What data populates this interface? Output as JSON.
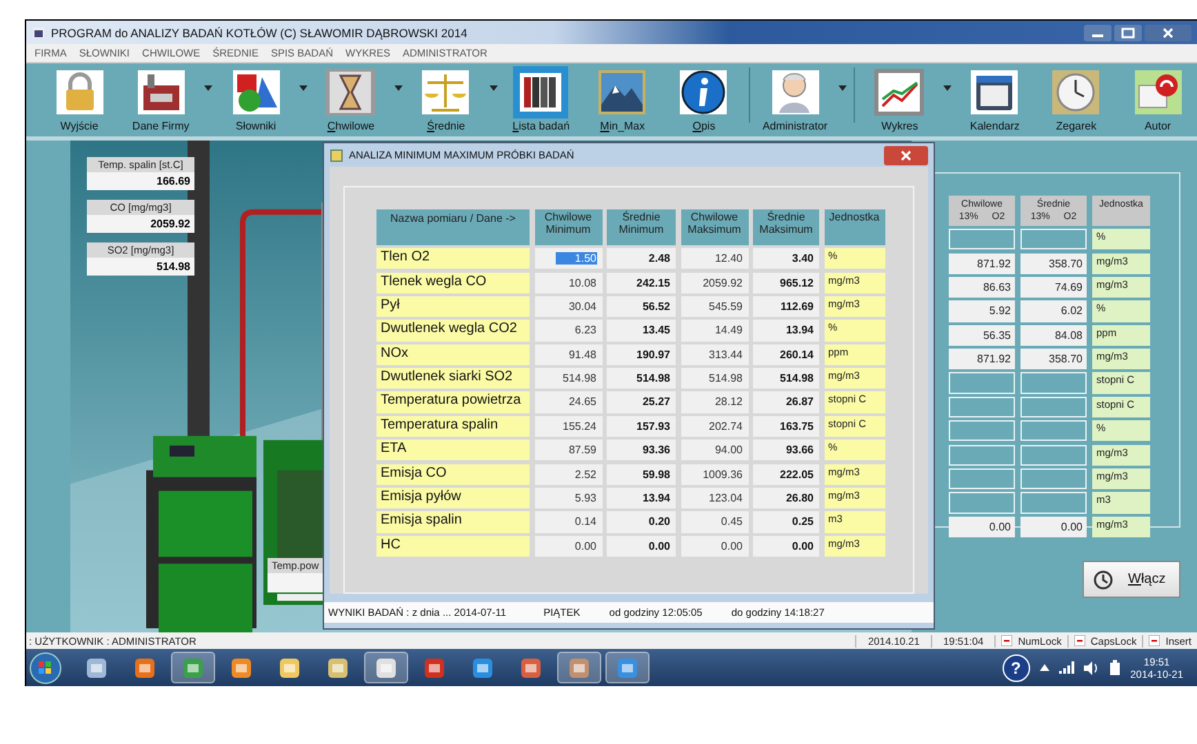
{
  "window": {
    "title": "PROGRAM do ANALIZY BADAŃ KOTŁÓW (C) SŁAWOMIR DĄBROWSKI 2014"
  },
  "menu": [
    "FIRMA",
    "SŁOWNIKI",
    "CHWILOWE",
    "ŚREDNIE",
    "SPIS BADAŃ",
    "WYKRES",
    "ADMINISTRATOR"
  ],
  "toolbar": [
    {
      "label": "Wyjście",
      "dropdown": false,
      "mnemonic": false,
      "selected": false,
      "separator_before": false
    },
    {
      "label": "Dane Firmy",
      "dropdown": true,
      "mnemonic": false,
      "selected": false,
      "separator_before": false
    },
    {
      "label": "Słowniki",
      "dropdown": true,
      "mnemonic": false,
      "selected": false,
      "separator_before": false
    },
    {
      "label": "Chwilowe",
      "dropdown": true,
      "mnemonic": true,
      "selected": false,
      "separator_before": false
    },
    {
      "label": "Średnie",
      "dropdown": true,
      "mnemonic": true,
      "selected": false,
      "separator_before": false
    },
    {
      "label": "Lista badań",
      "dropdown": false,
      "mnemonic": true,
      "selected": true,
      "separator_before": false
    },
    {
      "label": "Min_Max",
      "dropdown": false,
      "mnemonic": true,
      "selected": false,
      "separator_before": false
    },
    {
      "label": "Opis",
      "dropdown": false,
      "mnemonic": true,
      "selected": false,
      "separator_before": false
    },
    {
      "label": "Administrator",
      "dropdown": true,
      "mnemonic": false,
      "selected": false,
      "separator_before": true
    },
    {
      "label": "Wykres",
      "dropdown": true,
      "mnemonic": false,
      "selected": false,
      "separator_before": true
    },
    {
      "label": "Kalendarz",
      "dropdown": false,
      "mnemonic": false,
      "selected": false,
      "separator_before": false
    },
    {
      "label": "Zegarek",
      "dropdown": false,
      "mnemonic": false,
      "selected": false,
      "separator_before": false
    },
    {
      "label": "Autor",
      "dropdown": false,
      "mnemonic": false,
      "selected": false,
      "separator_before": false
    }
  ],
  "readouts": [
    {
      "label": "Temp. spalin [st.C]",
      "value": "166.69"
    },
    {
      "label": "CO [mg/mg3]",
      "value": "2059.92"
    },
    {
      "label": "SO2 [mg/mg3]",
      "value": "514.98"
    }
  ],
  "partial_readout": {
    "label": "Temp.pow"
  },
  "right_panel": {
    "columns": [
      "Chwilowe 13% O2",
      "Średnie 13% O2",
      "Jednostka"
    ],
    "rows": [
      {
        "unit": "%"
      },
      {
        "c13": "871.92",
        "s13": "358.70",
        "unit": "mg/m3"
      },
      {
        "c13": "86.63",
        "s13": "74.69",
        "unit": "mg/m3"
      },
      {
        "c13": "5.92",
        "s13": "6.02",
        "unit": "%"
      },
      {
        "c13": "56.35",
        "s13": "84.08",
        "unit": "ppm"
      },
      {
        "c13": "871.92",
        "s13": "358.70",
        "unit": "mg/m3"
      },
      {
        "unit": "stopni C"
      },
      {
        "unit": "stopni C"
      },
      {
        "unit": "%"
      },
      {
        "unit": "mg/m3"
      },
      {
        "unit": "mg/m3"
      },
      {
        "unit": "m3"
      },
      {
        "c13": "0.00",
        "s13": "0.00",
        "unit": "mg/m3"
      }
    ]
  },
  "button": {
    "label": "Włącz"
  },
  "dialog": {
    "title": "ANALIZA MINIMUM MAXIMUM PRÓBKI BADAŃ",
    "columns": [
      "Nazwa pomiaru / Dane ->",
      "Chwilowe Minimum",
      "Średnie Minimum",
      "Chwilowe Maksimum",
      "Średnie Maksimum",
      "Jednostka"
    ],
    "rows": [
      {
        "name": "Tlen O2",
        "cmin": "1.50",
        "smin": "2.48",
        "cmax": "12.40",
        "smax": "3.40",
        "unit": "%",
        "selected": true
      },
      {
        "name": "Tlenek wegla CO",
        "cmin": "10.08",
        "smin": "242.15",
        "cmax": "2059.92",
        "smax": "965.12",
        "unit": "mg/m3",
        "selected": false
      },
      {
        "name": "Pył",
        "cmin": "30.04",
        "smin": "56.52",
        "cmax": "545.59",
        "smax": "112.69",
        "unit": "mg/m3",
        "selected": false
      },
      {
        "name": "Dwutlenek wegla CO2",
        "cmin": "6.23",
        "smin": "13.45",
        "cmax": "14.49",
        "smax": "13.94",
        "unit": "%",
        "selected": false
      },
      {
        "name": "NOx",
        "cmin": "91.48",
        "smin": "190.97",
        "cmax": "313.44",
        "smax": "260.14",
        "unit": "ppm",
        "selected": false
      },
      {
        "name": "Dwutlenek siarki SO2",
        "cmin": "514.98",
        "smin": "514.98",
        "cmax": "514.98",
        "smax": "514.98",
        "unit": "mg/m3",
        "selected": false
      },
      {
        "name": "Temperatura powietrza",
        "cmin": "24.65",
        "smin": "25.27",
        "cmax": "28.12",
        "smax": "26.87",
        "unit": "stopni C",
        "selected": false
      },
      {
        "name": "Temperatura spalin",
        "cmin": "155.24",
        "smin": "157.93",
        "cmax": "202.74",
        "smax": "163.75",
        "unit": "stopni C",
        "selected": false
      },
      {
        "name": "ETA",
        "cmin": "87.59",
        "smin": "93.36",
        "cmax": "94.00",
        "smax": "93.66",
        "unit": "%",
        "selected": false
      },
      {
        "name": "Emisja CO",
        "cmin": "2.52",
        "smin": "59.98",
        "cmax": "1009.36",
        "smax": "222.05",
        "unit": "mg/m3",
        "selected": false
      },
      {
        "name": "Emisja pyłów",
        "cmin": "5.93",
        "smin": "13.94",
        "cmax": "123.04",
        "smax": "26.80",
        "unit": "mg/m3",
        "selected": false
      },
      {
        "name": "Emisja spalin",
        "cmin": "0.14",
        "smin": "0.20",
        "cmax": "0.45",
        "smax": "0.25",
        "unit": "m3",
        "selected": false
      },
      {
        "name": "HC",
        "cmin": "0.00",
        "smin": "0.00",
        "cmax": "0.00",
        "smax": "0.00",
        "unit": "mg/m3",
        "selected": false
      }
    ],
    "status": [
      "WYNIKI BADAŃ  : z dnia ... 2014-07-11",
      "PIĄTEK",
      "od godziny 12:05:05",
      "do godziny 14:18:27"
    ]
  },
  "status_bar": {
    "user": ": UŻYTKOWNIK : ADMINISTRATOR",
    "date": "2014.10.21",
    "time": "19:51:04",
    "keys": [
      "NumLock",
      "CapsLock",
      "Insert"
    ]
  },
  "taskbar": {
    "items": [
      {
        "active": false
      },
      {
        "active": false
      },
      {
        "active": true
      },
      {
        "active": false
      },
      {
        "active": false
      },
      {
        "active": false
      },
      {
        "active": true
      },
      {
        "active": false
      },
      {
        "active": false
      },
      {
        "active": false
      },
      {
        "active": true
      },
      {
        "active": true
      }
    ],
    "help": "?",
    "clock_time": "19:51",
    "clock_date": "2014-10-21"
  }
}
